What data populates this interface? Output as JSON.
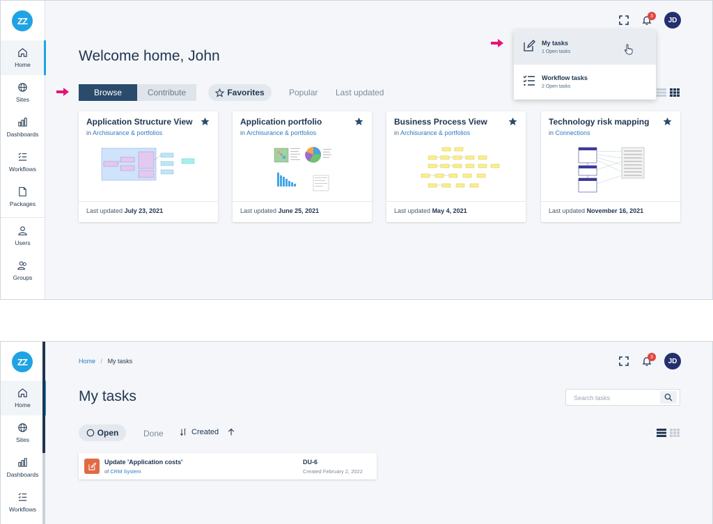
{
  "logo_text": "ZZ",
  "sidebar": {
    "items": [
      {
        "label": "Home",
        "icon": "home-icon"
      },
      {
        "label": "Sites",
        "icon": "globe-icon"
      },
      {
        "label": "Dashboards",
        "icon": "bar-chart-icon"
      },
      {
        "label": "Workflows",
        "icon": "checklist-icon"
      },
      {
        "label": "Packages",
        "icon": "file-icon"
      },
      {
        "label": "Users",
        "icon": "user-icon"
      },
      {
        "label": "Groups",
        "icon": "users-icon"
      }
    ]
  },
  "topbar": {
    "notification_count": "3",
    "avatar_initials": "JD"
  },
  "home": {
    "title": "Welcome home, John",
    "tabs": {
      "browse": "Browse",
      "contribute": "Contribute",
      "favorites": "Favorites",
      "popular": "Popular",
      "last_updated": "Last updated"
    },
    "cards": [
      {
        "title": "Application Structure View",
        "in_prefix": "in",
        "location": "Archisurance & portfolios",
        "updated_prefix": "Last updated",
        "updated": "July 23, 2021"
      },
      {
        "title": "Application portfolio",
        "in_prefix": "in",
        "location": "Archisurance & portfolios",
        "updated_prefix": "Last updated",
        "updated": "June 25, 2021"
      },
      {
        "title": "Business Process View",
        "in_prefix": "in",
        "location": "Archisurance & portfolios",
        "updated_prefix": "Last updated",
        "updated": "May 4, 2021"
      },
      {
        "title": "Technology risk mapping",
        "in_prefix": "in",
        "location": "Connections",
        "updated_prefix": "Last updated",
        "updated": "November 16, 2021"
      }
    ],
    "dropdown": [
      {
        "title": "My tasks",
        "sub": "1 Open tasks"
      },
      {
        "title": "Workflow tasks",
        "sub": "2 Open tasks"
      }
    ]
  },
  "tasks": {
    "breadcrumb": {
      "home": "Home",
      "sep": "/",
      "current": "My tasks"
    },
    "title": "My tasks",
    "search_placeholder": "Search tasks",
    "filters": {
      "open": "Open",
      "done": "Done",
      "sort": "Created"
    },
    "items": [
      {
        "title": "Update 'Application costs'",
        "of_prefix": "of",
        "target": "CRM System",
        "id": "DU-6",
        "created": "Created February 2, 2022"
      }
    ]
  },
  "colors": {
    "accent": "#1fa3e3",
    "primary": "#2a4b6b",
    "arrow": "#e8117a",
    "badge": "#e0453d"
  }
}
